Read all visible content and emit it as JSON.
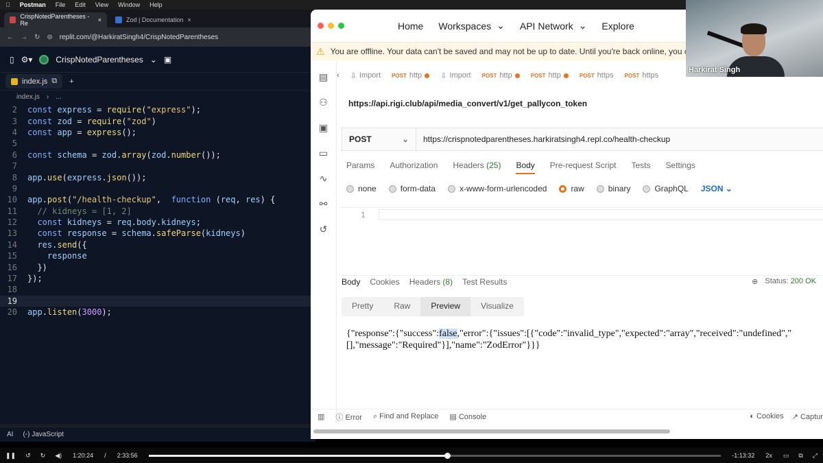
{
  "menubar": {
    "app": "Postman",
    "items": [
      "File",
      "Edit",
      "View",
      "Window",
      "Help"
    ]
  },
  "browser": {
    "tabs": [
      {
        "label": "CrispNotedParentheses - Re"
      },
      {
        "label": "Zod | Documentation"
      }
    ],
    "url": "replit.com/@HarkiratSingh4/CrispNotedParentheses"
  },
  "replit": {
    "project": "CrispNotedParentheses",
    "file_tab": "index.js",
    "breadcrumb": "index.js",
    "breadcrumb_more": "...",
    "code": [
      {
        "n": "2",
        "html": "<span class=\"kw\">const</span> <span class=\"id\">express</span> = <span class=\"fn\">require</span>(<span class=\"str\">\"express\"</span>);"
      },
      {
        "n": "3",
        "html": "<span class=\"kw\">const</span> <span class=\"id\">zod</span> = <span class=\"fn\">require</span>(<span class=\"str\">\"zod\"</span>)"
      },
      {
        "n": "4",
        "html": "<span class=\"kw\">const</span> <span class=\"id\">app</span> = <span class=\"fn\">express</span>();"
      },
      {
        "n": "5",
        "html": ""
      },
      {
        "n": "6",
        "html": "<span class=\"kw\">const</span> <span class=\"id\">schema</span> = <span class=\"id\">zod</span>.<span class=\"fn\">array</span>(<span class=\"id\">zod</span>.<span class=\"fn\">number</span>());"
      },
      {
        "n": "7",
        "html": ""
      },
      {
        "n": "8",
        "html": "<span class=\"id\">app</span>.<span class=\"fn\">use</span>(<span class=\"id\">express</span>.<span class=\"fn\">json</span>());"
      },
      {
        "n": "9",
        "html": ""
      },
      {
        "n": "10",
        "html": "<span class=\"id\">app</span>.<span class=\"fn\">post</span>(<span class=\"str\">\"/health-checkup\"</span>,  <span class=\"kw\">function</span> (<span class=\"id\">req</span>, <span class=\"id\">res</span>) {"
      },
      {
        "n": "11",
        "html": "  <span class=\"cm\">// kidneys = [1, 2]</span>"
      },
      {
        "n": "12",
        "html": "  <span class=\"kw\">const</span> <span class=\"id\">kidneys</span> = <span class=\"id\">req</span>.<span class=\"id\">body</span>.<span class=\"id\">kidneys</span>;"
      },
      {
        "n": "13",
        "html": "  <span class=\"kw\">const</span> <span class=\"id\">response</span> = <span class=\"id\">schema</span>.<span class=\"fn\">safeParse</span>(<span class=\"id\">kidneys</span>)"
      },
      {
        "n": "14",
        "html": "  <span class=\"id\">res</span>.<span class=\"fn\">send</span>({"
      },
      {
        "n": "15",
        "html": "    <span class=\"id\">response</span>"
      },
      {
        "n": "16",
        "html": "  })"
      },
      {
        "n": "17",
        "html": "});"
      },
      {
        "n": "18",
        "html": ""
      },
      {
        "n": "19",
        "html": "",
        "current": true
      },
      {
        "n": "20",
        "html": "<span class=\"id\">app</span>.<span class=\"fn\">listen</span>(<span class=\"num\">3000</span>);"
      }
    ],
    "status": {
      "ai": "AI",
      "lang": "JavaScript"
    }
  },
  "postman": {
    "nav": {
      "home": "Home",
      "workspaces": "Workspaces",
      "api_network": "API Network",
      "explore": "Explore"
    },
    "offline_banner": "You are offline. Your data can't be saved and may not be up to date. Until you're back online, you c",
    "request_tabs": [
      {
        "method": "",
        "label": "Import",
        "dot": false
      },
      {
        "method": "POST",
        "label": "http",
        "dot": true
      },
      {
        "method": "",
        "label": "Import",
        "dot": false
      },
      {
        "method": "POST",
        "label": "http",
        "dot": true
      },
      {
        "method": "POST",
        "label": "http",
        "dot": true
      },
      {
        "method": "POST",
        "label": "https",
        "dot": false
      },
      {
        "method": "POST",
        "label": "https",
        "dot": false
      }
    ],
    "request_name": "https://api.rigi.club/api/media_convert/v1/get_pallycon_token",
    "method": "POST",
    "url": "https://crispnotedparentheses.harkiratsingh4.repl.co/health-checkup",
    "request_subtabs": {
      "params": "Params",
      "authorization": "Authorization",
      "headers": "Headers",
      "headers_count": "(25)",
      "body": "Body",
      "prerequest": "Pre-request Script",
      "tests": "Tests",
      "settings": "Settings"
    },
    "body_options": {
      "none": "none",
      "form_data": "form-data",
      "urlencoded": "x-www-form-urlencoded",
      "raw": "raw",
      "binary": "binary",
      "graphql": "GraphQL",
      "format": "JSON"
    },
    "editor_line": "1",
    "response_tabs": {
      "body": "Body",
      "cookies": "Cookies",
      "headers": "Headers",
      "headers_count": "(8)",
      "test_results": "Test Results"
    },
    "status_label": "Status:",
    "status_value": "200 OK",
    "views": {
      "pretty": "Pretty",
      "raw": "Raw",
      "preview": "Preview",
      "visualize": "Visualize"
    },
    "response_line1_a": "{\"response\":{\"success\":",
    "response_line1_sel": "false",
    "response_line1_b": ",\"error\":{\"issues\":[{\"code\":\"invalid_type\",\"expected\":\"array\",\"received\":\"undefined\",\"",
    "response_line2": "[],\"message\":\"Required\"}],\"name\":\"ZodError\"}}}",
    "footer": {
      "error": "Error",
      "find": "Find and Replace",
      "console": "Console",
      "cookies": "Cookies",
      "capture": "Captur"
    }
  },
  "webcam": {
    "name": "Harkirat Singh"
  },
  "player": {
    "elapsed": "1:20:24",
    "total": "2:33:56",
    "remaining": "-1:13:32",
    "speed": "2x",
    "progress": 0.522
  }
}
